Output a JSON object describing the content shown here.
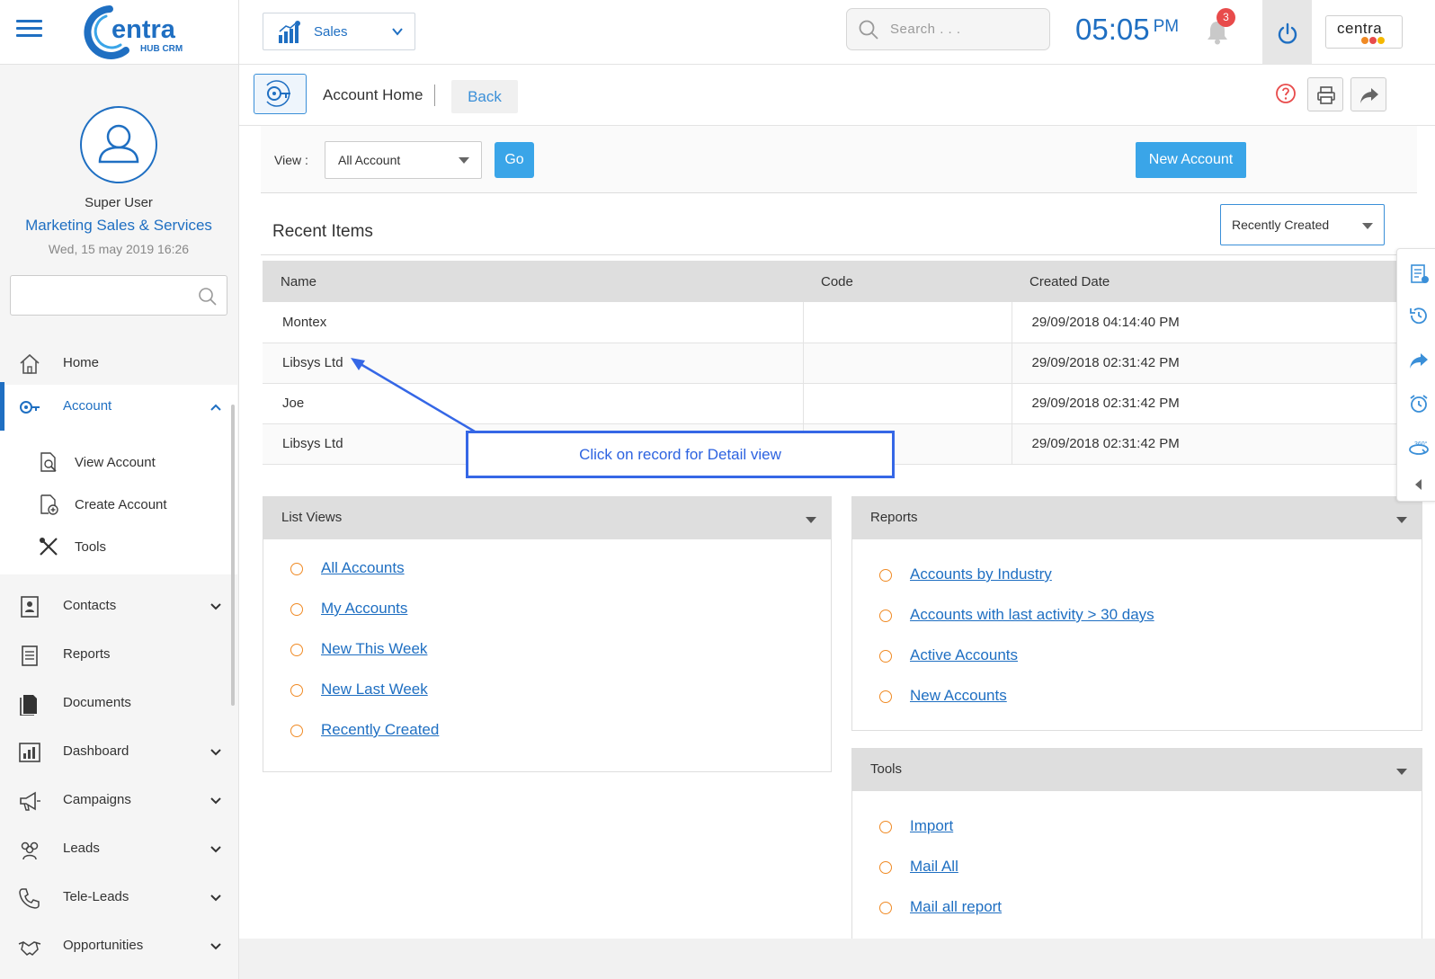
{
  "header": {
    "logo_text": "Centra",
    "logo_sub": "HUB CRM",
    "module": "Sales",
    "search_placeholder": "Search . . .",
    "time": "05:05",
    "ampm": "PM",
    "notification_count": "3",
    "brand": "centra"
  },
  "user": {
    "name": "Super User",
    "org": "Marketing Sales & Services",
    "date": "Wed, 15 may 2019 16:26"
  },
  "sidebar": {
    "items": [
      {
        "label": "Home"
      },
      {
        "label": "Account"
      },
      {
        "label": "Contacts"
      },
      {
        "label": "Reports"
      },
      {
        "label": "Documents"
      },
      {
        "label": "Dashboard"
      },
      {
        "label": "Campaigns"
      },
      {
        "label": "Leads"
      },
      {
        "label": "Tele-Leads"
      },
      {
        "label": "Opportunities"
      }
    ],
    "account_sub": [
      {
        "label": "View Account"
      },
      {
        "label": "Create Account"
      },
      {
        "label": "Tools"
      }
    ]
  },
  "breadcrumb": {
    "title": "Account Home",
    "back": "Back"
  },
  "view_bar": {
    "label": "View :",
    "selected": "All Account",
    "go": "Go",
    "new_account": "New Account"
  },
  "recent": {
    "title": "Recent Items",
    "sort_selected": "Recently Created",
    "columns": [
      "Name",
      "Code",
      "Created Date"
    ],
    "rows": [
      [
        "Montex",
        "",
        "29/09/2018 04:14:40 PM"
      ],
      [
        "Libsys Ltd",
        "",
        "29/09/2018 02:31:42 PM"
      ],
      [
        "Joe",
        "",
        "29/09/2018 02:31:42 PM"
      ],
      [
        "Libsys Ltd",
        "",
        "29/09/2018 02:31:42 PM"
      ]
    ]
  },
  "callout": "Click on record for Detail view",
  "list_views": {
    "title": "List Views",
    "items": [
      "All Accounts",
      "My Accounts",
      "New This Week",
      "New Last Week",
      "Recently Created"
    ]
  },
  "reports": {
    "title": "Reports",
    "items": [
      " Accounts by Industry",
      "Accounts with last activity > 30 days",
      "Active Accounts",
      "New Accounts"
    ]
  },
  "tools": {
    "title": "Tools",
    "items": [
      " Import",
      "Mail All",
      "Mail all report"
    ]
  },
  "colors": {
    "primary": "#1f6fc2",
    "button": "#3aa5e8",
    "bullet": "#f08a24",
    "badge": "#e84b4b",
    "callout": "#3567e6"
  }
}
